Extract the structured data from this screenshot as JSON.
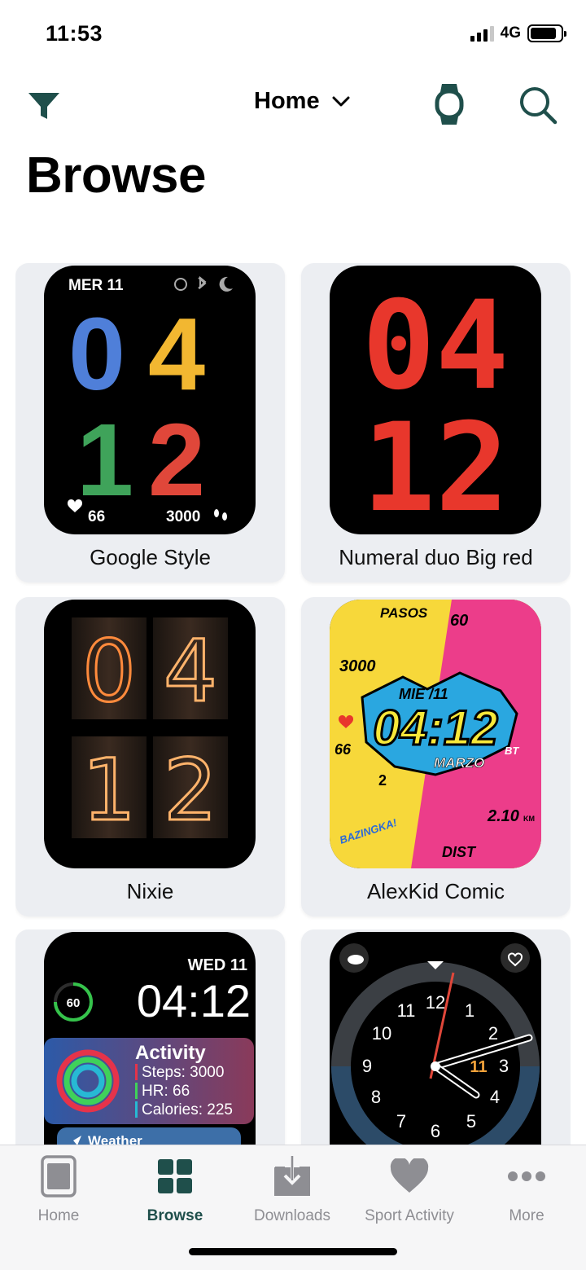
{
  "status": {
    "time": "11:53",
    "network": "4G"
  },
  "nav": {
    "location": "Home"
  },
  "page": {
    "title": "Browse"
  },
  "faces": [
    {
      "label": "Google Style",
      "date": "MER 11",
      "hours": "04",
      "minutes": "12",
      "heart": "66",
      "steps": "3000"
    },
    {
      "label": "Numeral duo Big red",
      "hours": "04",
      "minutes": "12"
    },
    {
      "label": "Nixie",
      "digits": [
        "0",
        "4",
        "1",
        "2"
      ]
    },
    {
      "label": "AlexKid Comic",
      "pasos": "PASOS",
      "steps": "3000",
      "battery": "60",
      "date": "MIE /11",
      "time": "04:12",
      "month": "MARZO",
      "heart": "66",
      "temp": "2",
      "distance": "2.10",
      "dist_unit": "KM",
      "dist_label": "DIST",
      "bazinga": "BAZINGKA!",
      "bt": "BT"
    },
    {
      "label": "",
      "date": "WED 11",
      "time": "04:12",
      "ring": "60",
      "activity_title": "Activity",
      "steps": "Steps: 3000",
      "hr": "HR: 66",
      "calories": "Calories: 225",
      "weather": "Weather"
    },
    {
      "label": "",
      "numerals": [
        "12",
        "1",
        "2",
        "3",
        "4",
        "5",
        "6",
        "7",
        "8",
        "9",
        "10",
        "11"
      ],
      "date_window": "11"
    }
  ],
  "tabs": [
    {
      "label": "Home",
      "icon": "home-watch-icon",
      "active": false
    },
    {
      "label": "Browse",
      "icon": "grid-icon",
      "active": true
    },
    {
      "label": "Downloads",
      "icon": "download-icon",
      "active": false
    },
    {
      "label": "Sport Activity",
      "icon": "heart-icon",
      "active": false
    },
    {
      "label": "More",
      "icon": "more-dots-icon",
      "active": false
    }
  ],
  "colors": {
    "accent": "#1f4f4b",
    "inactive": "#8e8e93",
    "card": "#eceef2",
    "red": "#e8372c"
  }
}
